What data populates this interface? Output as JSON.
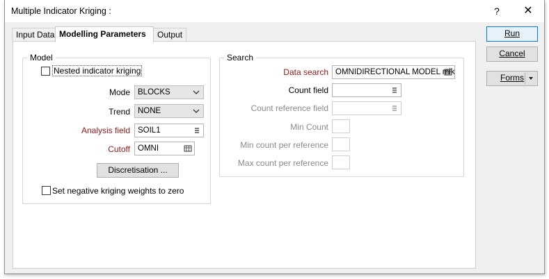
{
  "window": {
    "title": "Multiple Indicator Kriging :",
    "help_label": "?",
    "close_label": "✕"
  },
  "tabs": [
    {
      "label": "Input Data",
      "active": false
    },
    {
      "label": "Modelling Parameters",
      "active": true
    },
    {
      "label": "Output",
      "active": false
    }
  ],
  "model": {
    "group_title": "Model",
    "nested_label": "Nested indicator kriging",
    "nested_checked": false,
    "mode_label": "Mode",
    "mode_value": "BLOCKS",
    "trend_label": "Trend",
    "trend_value": "NONE",
    "analysis_label": "Analysis field",
    "analysis_value": "SOIL1",
    "cutoff_label": "Cutoff",
    "cutoff_value": "OMNI",
    "discretisation_label": "Discretisation ...",
    "negative_label": "Set negative kriging weights to zero",
    "negative_checked": false
  },
  "search": {
    "group_title": "Search",
    "data_search_label": "Data search",
    "data_search_value": "OMNIDIRECTIONAL MODEL mik",
    "count_field_label": "Count field",
    "count_field_value": "",
    "count_ref_label": "Count reference field",
    "count_ref_value": "",
    "min_count_label": "Min Count",
    "min_count_ref_label": "Min count per reference",
    "max_count_ref_label": "Max count per reference"
  },
  "actions": {
    "run_label": "Run",
    "cancel_label": "Cancel",
    "forms_label": "Forms"
  },
  "colors": {
    "required_label": "#8b1a1a",
    "disabled_label": "#8a8a8a",
    "primary_border": "#0078d7"
  }
}
